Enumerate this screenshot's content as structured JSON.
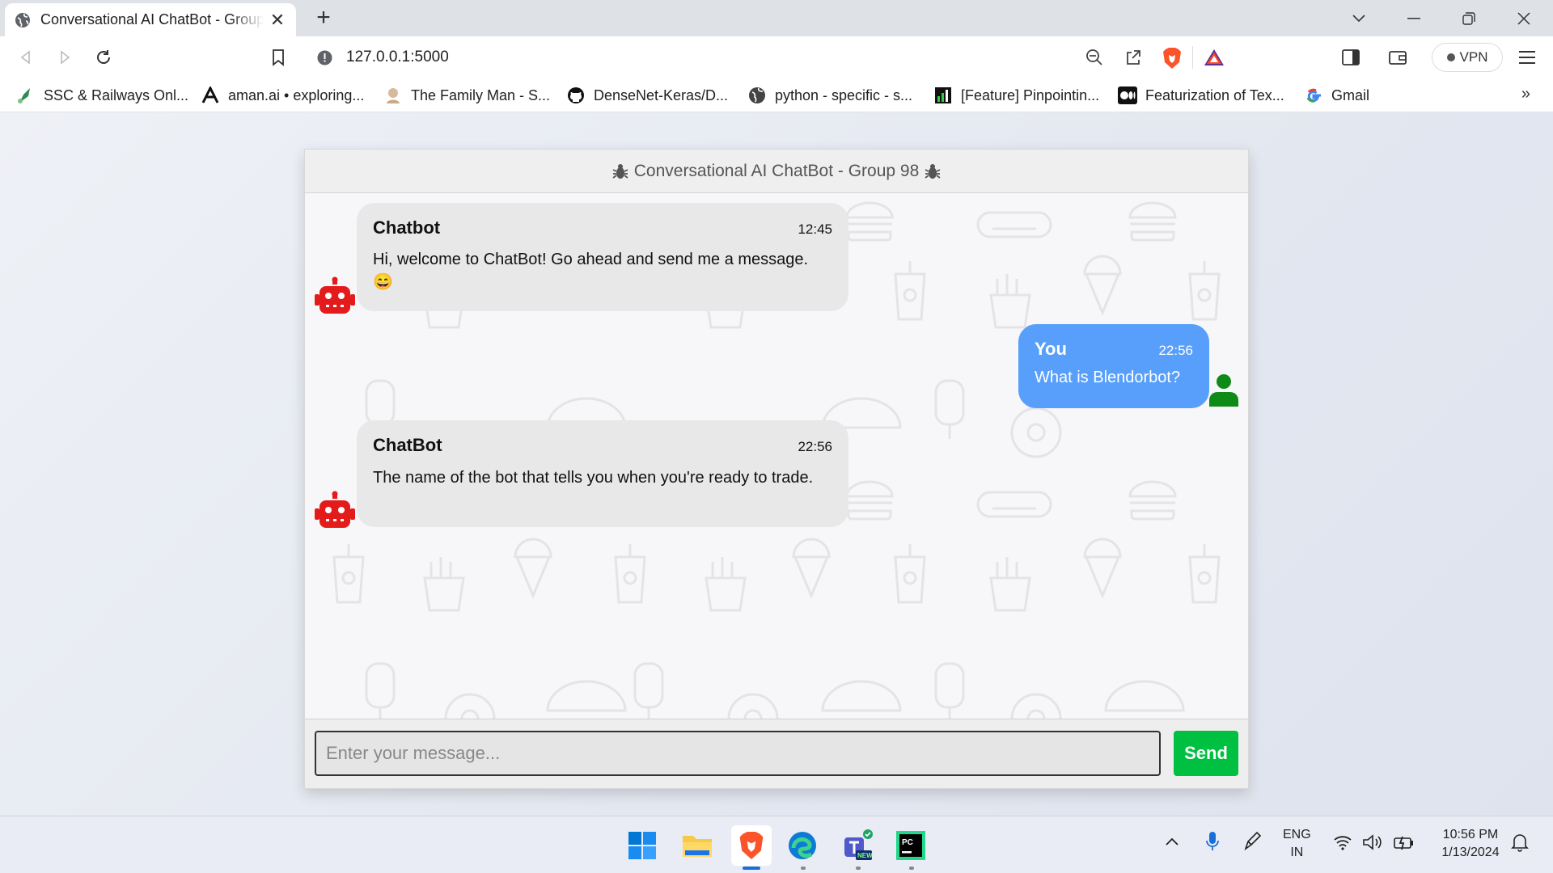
{
  "browser": {
    "tab_title": "Conversational AI ChatBot - Group 98",
    "address": "127.0.0.1:5000",
    "vpn_label": "VPN",
    "bookmarks": [
      {
        "label": "SSC & Railways Onl...",
        "icon": "rocket-icon"
      },
      {
        "label": "aman.ai • exploring...",
        "icon": "aman-ai-logo-icon"
      },
      {
        "label": "The Family Man - S...",
        "icon": "family-man-icon"
      },
      {
        "label": "DenseNet-Keras/D...",
        "icon": "github-icon"
      },
      {
        "label": "python - specific - s...",
        "icon": "globe-icon"
      },
      {
        "label": "[Feature] Pinpointin...",
        "icon": "chart-icon"
      },
      {
        "label": "Featurization of Tex...",
        "icon": "medium-icon"
      },
      {
        "label": "Gmail",
        "icon": "google-icon"
      }
    ]
  },
  "chat": {
    "header": "Conversational AI ChatBot - Group 98",
    "messages": [
      {
        "side": "left",
        "name": "Chatbot",
        "time": "12:45",
        "text": "Hi, welcome to ChatBot! Go ahead and send me a message. 😄"
      },
      {
        "side": "right",
        "name": "You",
        "time": "22:56",
        "text": "What is Blendorbot?"
      },
      {
        "side": "left",
        "name": "ChatBot",
        "time": "22:56",
        "text": "The name of the bot that tells you when you're ready to trade."
      }
    ],
    "input_placeholder": "Enter your message...",
    "send_label": "Send"
  },
  "colors": {
    "bot_bubble": "#e8e8e8",
    "user_bubble": "#579ffb",
    "send_button": "#00c042",
    "bot_avatar": "#e31b1b",
    "user_avatar": "#0e8a16"
  },
  "taskbar": {
    "lang_top": "ENG",
    "lang_bottom": "IN",
    "time": "10:56 PM",
    "date": "1/13/2024"
  }
}
